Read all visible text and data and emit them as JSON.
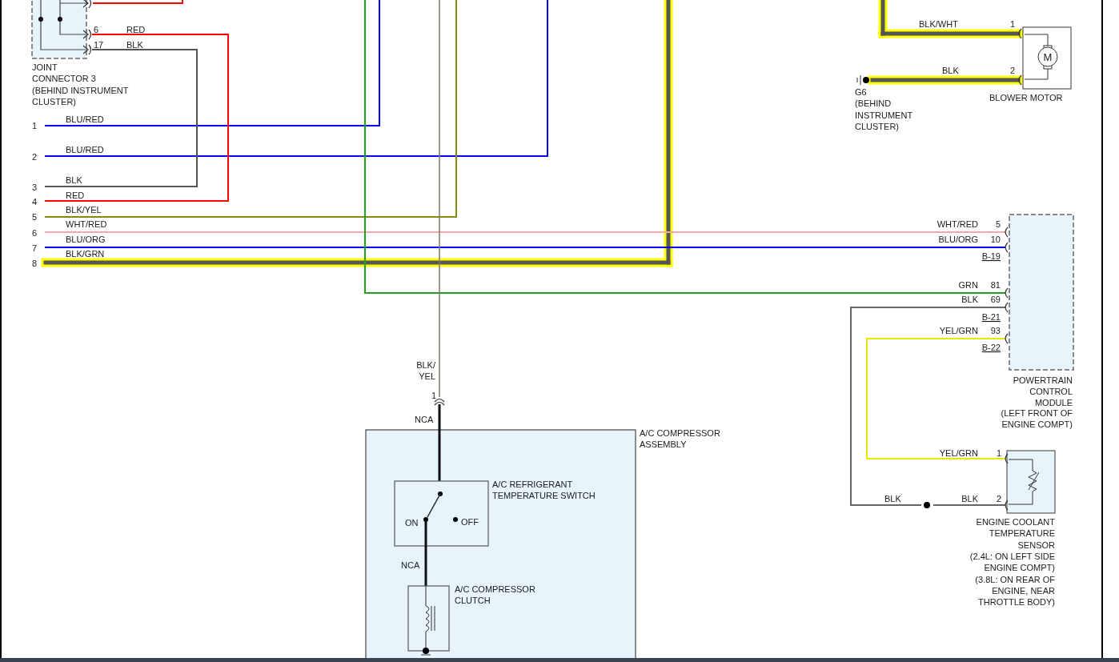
{
  "joint_connector": {
    "label": [
      "JOINT",
      "CONNECTOR 3",
      "(BEHIND INSTRUMENT",
      "CLUSTER)"
    ],
    "pins": [
      {
        "pin": "6",
        "wire": "RED"
      },
      {
        "pin": "17",
        "wire": "BLK"
      }
    ]
  },
  "harness": [
    {
      "pin": "1",
      "wire": "BLU/RED",
      "color": "#0000ff",
      "highlighted": false
    },
    {
      "pin": "2",
      "wire": "BLU/RED",
      "color": "#0000ff",
      "highlighted": false
    },
    {
      "pin": "3",
      "wire": "BLK",
      "color": "#555555",
      "highlighted": false
    },
    {
      "pin": "4",
      "wire": "RED",
      "color": "#ff0000",
      "highlighted": false
    },
    {
      "pin": "5",
      "wire": "BLK/YEL",
      "color": "#8a8a00",
      "highlighted": false
    },
    {
      "pin": "6",
      "wire": "WHT/RED",
      "color": "#f4a7a7",
      "highlighted": false
    },
    {
      "pin": "7",
      "wire": "BLU/ORG",
      "color": "#0000ff",
      "highlighted": false
    },
    {
      "pin": "8",
      "wire": "BLK/GRN",
      "color": "#555555",
      "highlighted": true
    }
  ],
  "blower_motor": {
    "label": "BLOWER MOTOR",
    "symbol": "M",
    "pins": [
      {
        "pin": "1",
        "wire": "BLK/WHT",
        "highlighted": true
      },
      {
        "pin": "2",
        "wire": "BLK",
        "highlighted": true
      }
    ]
  },
  "ground": {
    "label": [
      "G6",
      "(BEHIND",
      "INSTRUMENT",
      "CLUSTER)"
    ]
  },
  "pcm": {
    "label": [
      "POWERTRAIN",
      "CONTROL",
      "MODULE",
      "(LEFT FRONT OF",
      "ENGINE COMPT)"
    ],
    "connectors": [
      {
        "name": "B-19",
        "pins": [
          {
            "pin": "5",
            "wire": "WHT/RED"
          },
          {
            "pin": "10",
            "wire": "BLU/ORG"
          }
        ]
      },
      {
        "name": "B-21",
        "pins": [
          {
            "pin": "81",
            "wire": "GRN",
            "color": "#1fa01f"
          },
          {
            "pin": "69",
            "wire": "BLK",
            "color": "#666666"
          }
        ]
      },
      {
        "name": "B-22",
        "pins": [
          {
            "pin": "93",
            "wire": "YEL/GRN",
            "color": "#e8e800"
          }
        ]
      }
    ]
  },
  "compressor_feed": {
    "wire": [
      "BLK/",
      "YEL"
    ],
    "pin": "1",
    "inside_wire": "NCA"
  },
  "ac_compressor": {
    "label": [
      "A/C COMPRESSOR",
      "ASSEMBLY"
    ],
    "switch": {
      "label": [
        "A/C REFRIGERANT",
        "TEMPERATURE SWITCH"
      ],
      "on_label": "ON",
      "off_label": "OFF",
      "on": true
    },
    "link_wire": "NCA",
    "clutch": {
      "label": [
        "A/C COMPRESSOR",
        "CLUTCH"
      ]
    }
  },
  "ect_sensor": {
    "label": [
      "ENGINE COOLANT",
      "TEMPERATURE",
      "SENSOR",
      "(2.4L: ON LEFT SIDE",
      "ENGINE COMPT)",
      "(3.8L: ON REAR OF",
      "ENGINE, NEAR",
      "THROTTLE BODY)"
    ],
    "ground_wire": "BLK",
    "pins": [
      {
        "pin": "1",
        "wire": "YEL/GRN"
      },
      {
        "pin": "2",
        "wire": "BLK"
      }
    ]
  }
}
